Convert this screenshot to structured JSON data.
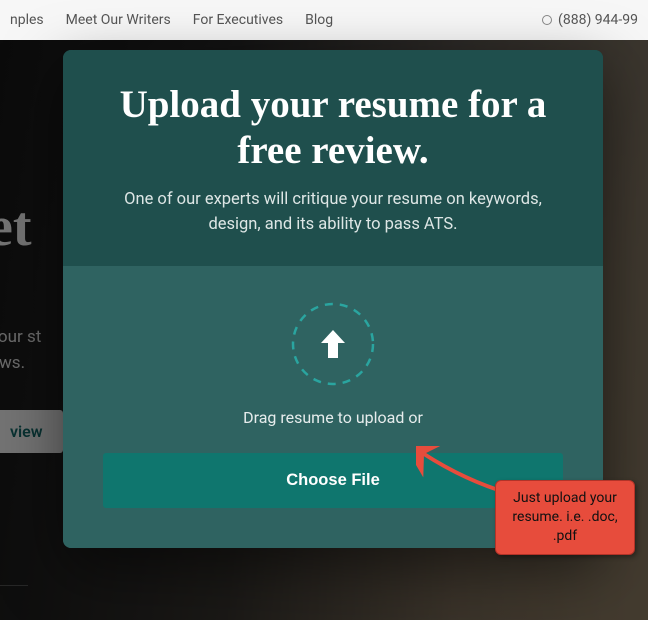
{
  "topnav": {
    "items": [
      "nples",
      "Meet Our Writers",
      "For Executives",
      "Blog"
    ],
    "phone": "(888) 944-99"
  },
  "hero": {
    "get": "get",
    "line1": "your st",
    "line2": "ews.",
    "cta": "view"
  },
  "modal": {
    "title": "Upload your resume for a free review.",
    "subtitle": "One of our experts will critique your resume on keywords, design, and its ability to pass ATS.",
    "instruction": "Drag resume to upload or",
    "button": "Choose File"
  },
  "callout": {
    "text": "Just upload your resume. i.e. .doc, .pdf"
  }
}
